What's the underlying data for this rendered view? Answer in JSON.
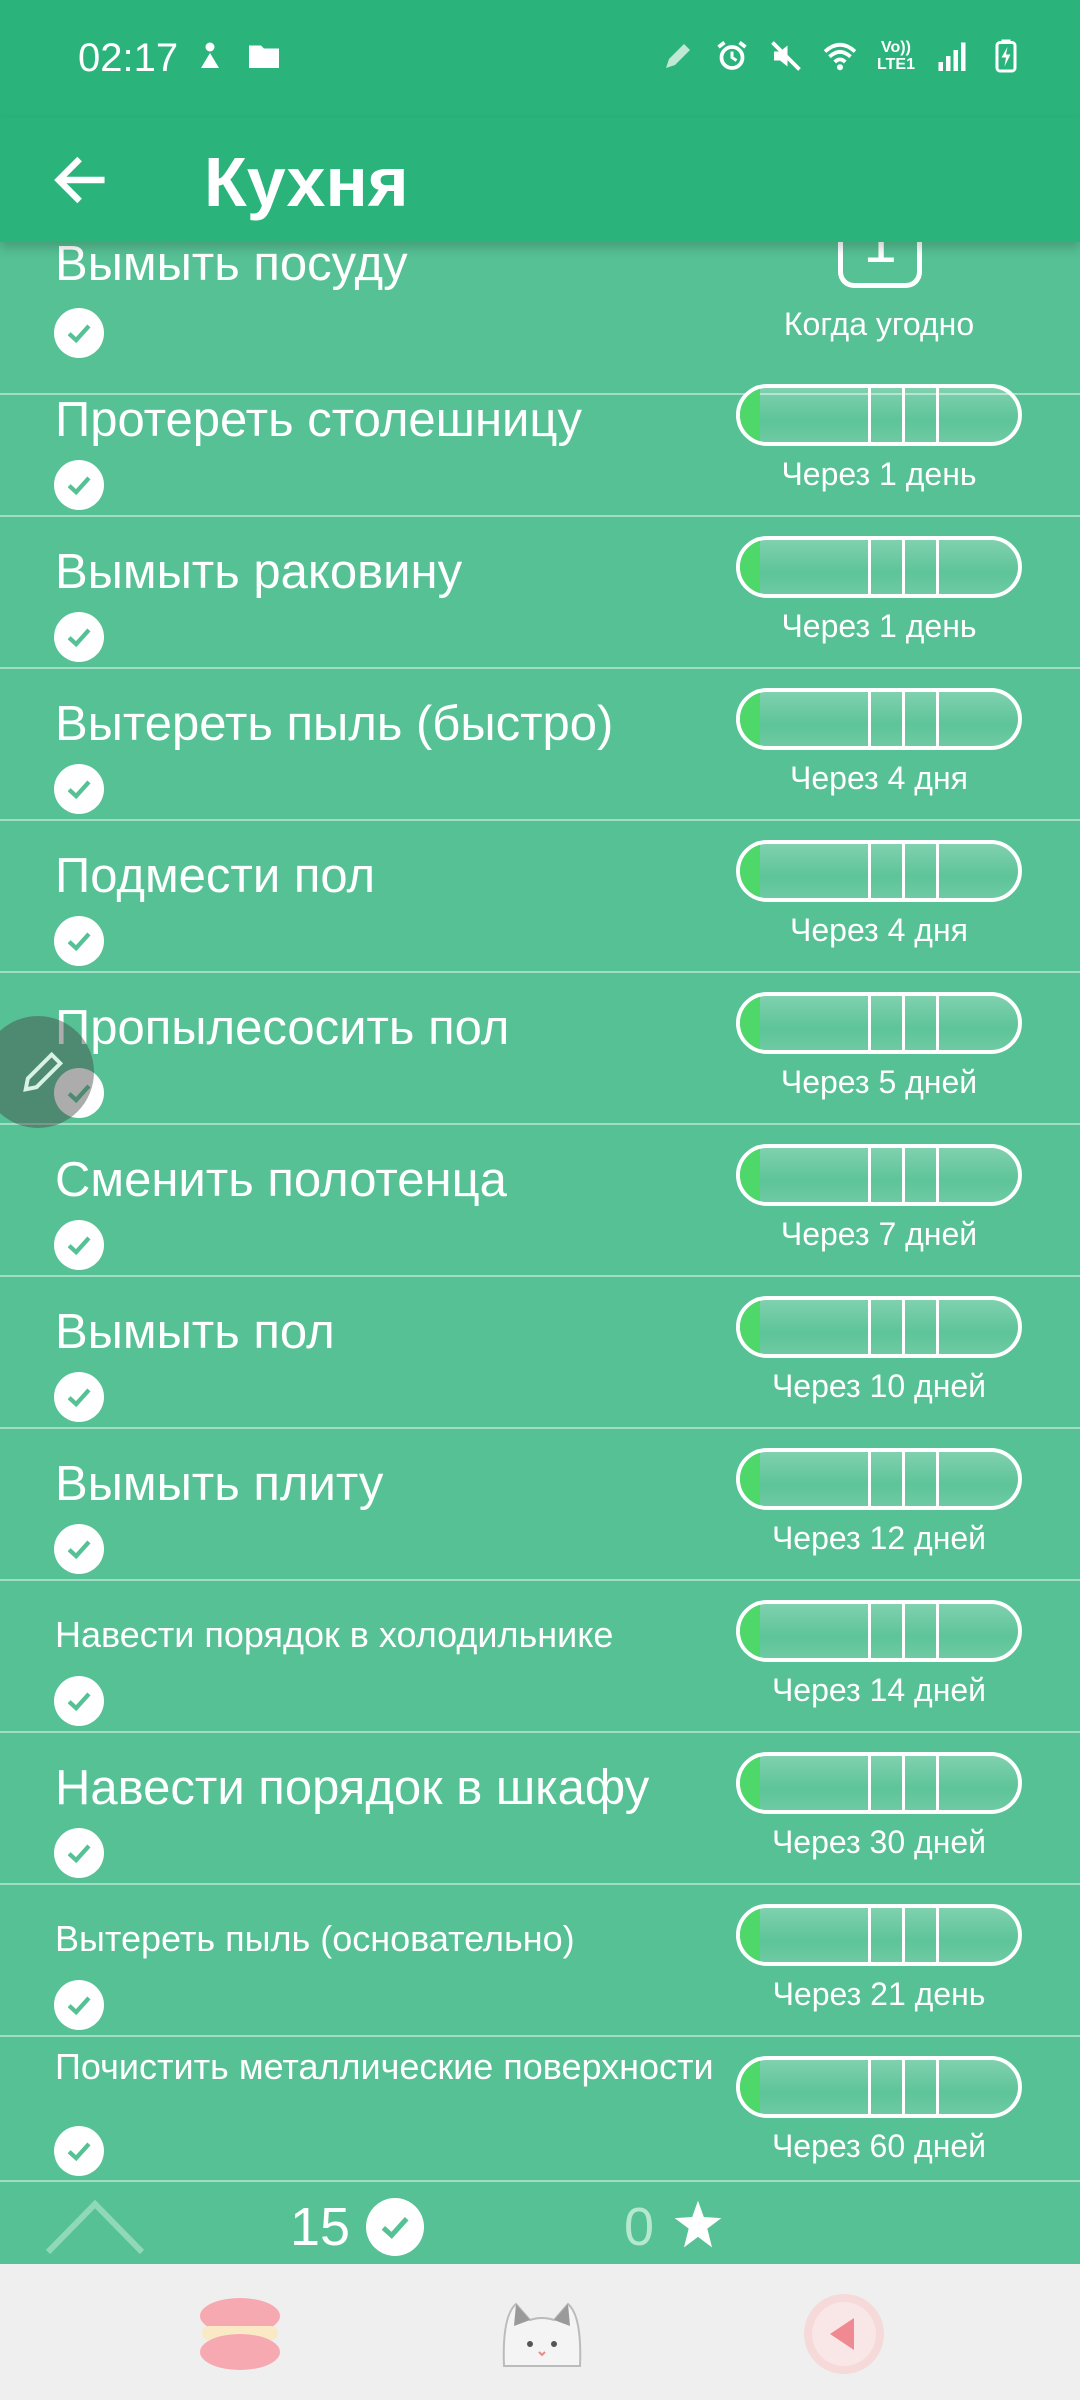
{
  "status_bar": {
    "time": "02:17",
    "volte_label": "Vo))\nLTE1"
  },
  "app_bar": {
    "title": "Кухня"
  },
  "tasks": [
    {
      "name": "Вымыть посуду",
      "due": "Когда угодно",
      "count": "1",
      "progress": null
    },
    {
      "name": "Протереть столешницу",
      "due": "Через 1 день",
      "progress": 0.05
    },
    {
      "name": "Вымыть раковину",
      "due": "Через 1 день",
      "progress": 0.05
    },
    {
      "name": "Вытереть пыль (быстро)",
      "due": "Через 4 дня",
      "progress": 0.05
    },
    {
      "name": "Подмести пол",
      "due": "Через 4 дня",
      "progress": 0.05
    },
    {
      "name": "Пропылесосить пол",
      "due": "Через 5 дней",
      "progress": 0.05
    },
    {
      "name": "Сменить полотенца",
      "due": "Через 7 дней",
      "progress": 0.05
    },
    {
      "name": "Вымыть пол",
      "due": "Через 10 дней",
      "progress": 0.05
    },
    {
      "name": "Вымыть плиту",
      "due": "Через 12 дней",
      "progress": 0.05
    },
    {
      "name": "Навести порядок в холодильнике",
      "due": "Через 14 дней",
      "progress": 0.05
    },
    {
      "name": "Навести порядок в шкафу",
      "due": "Через 30 дней",
      "progress": 0.05
    },
    {
      "name": "Вытереть пыль (основательно)",
      "due": "Через 21 день",
      "progress": 0.05
    },
    {
      "name": "Почистить металлические поверхности",
      "due": "Через 60 дней",
      "progress": 0.05
    }
  ],
  "summary": {
    "done_count": "15",
    "star_count": "0"
  },
  "colors": {
    "app_bar": "#2ab47c",
    "list_background": "#55c194",
    "progress_fill": "#4fd86a",
    "bottom_nav": "#efefef"
  }
}
